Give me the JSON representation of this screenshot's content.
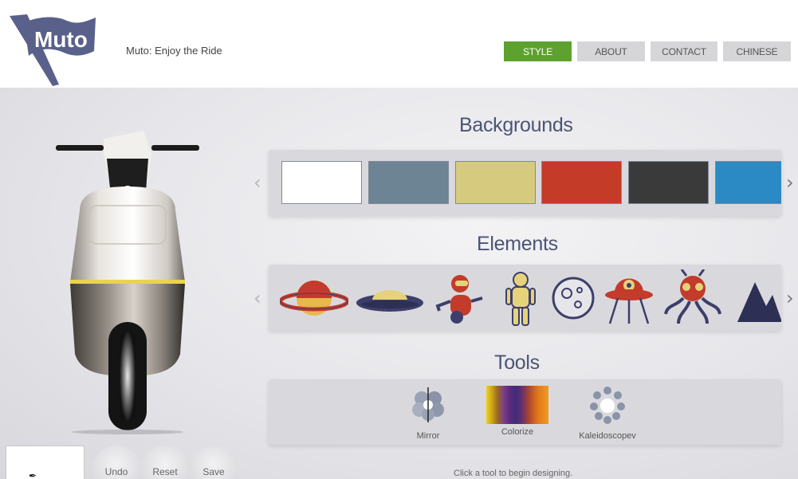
{
  "header": {
    "logo_text": "Muto",
    "tagline": "Muto: Enjoy the Ride",
    "nav": [
      {
        "label": "STYLE",
        "active": true
      },
      {
        "label": "ABOUT",
        "active": false
      },
      {
        "label": "CONTACT",
        "active": false
      },
      {
        "label": "CHINESE",
        "active": false
      }
    ]
  },
  "sections": {
    "backgrounds_title": "Backgrounds",
    "elements_title": "Elements",
    "tools_title": "Tools"
  },
  "backgrounds": {
    "swatches": [
      {
        "name": "white",
        "color": "#ffffff"
      },
      {
        "name": "slate",
        "color": "#6d8494"
      },
      {
        "name": "khaki",
        "color": "#d6ca7e"
      },
      {
        "name": "red",
        "color": "#c43b27"
      },
      {
        "name": "charcoal",
        "color": "#3a3a3a"
      },
      {
        "name": "blue",
        "color": "#2b8ac4"
      }
    ]
  },
  "elements": {
    "items": [
      "ringed-planet-icon",
      "flying-saucer-icon",
      "robot-icon",
      "astronaut-icon",
      "moon-icon",
      "ufo-icon",
      "octopus-alien-icon",
      "mountains-icon"
    ]
  },
  "tools": {
    "items": [
      {
        "label": "Mirror",
        "icon": "mirror-icon"
      },
      {
        "label": "Colorize",
        "icon": "colorize-icon"
      },
      {
        "label": "Kaleidoscopev",
        "icon": "kaleidoscope-icon"
      }
    ]
  },
  "actions": {
    "undo": "Undo",
    "reset": "Reset",
    "save": "Save"
  },
  "hint": "Click a tool to begin designing.",
  "colors": {
    "accent": "#5da22e",
    "title": "#4b5474",
    "logo": "#59608a"
  }
}
